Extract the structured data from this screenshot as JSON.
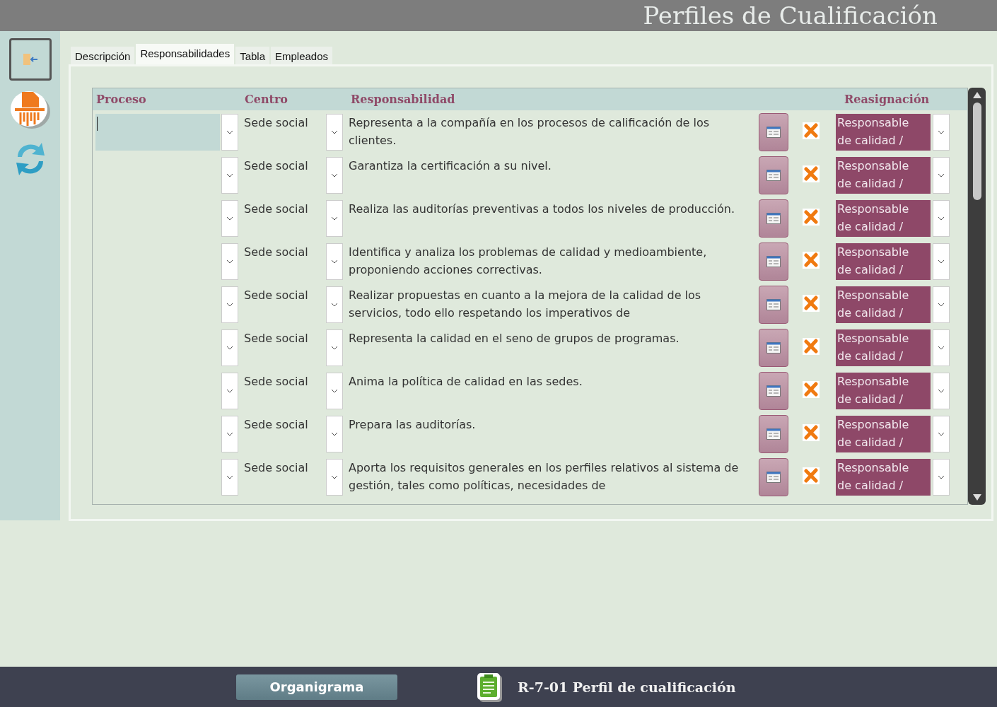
{
  "window": {
    "title": "Perfiles de Cualificación"
  },
  "tabs": [
    {
      "label": "Descripción",
      "selected": false
    },
    {
      "label": "Responsabilidades",
      "selected": true
    },
    {
      "label": "Tabla",
      "selected": false
    },
    {
      "label": "Empleados",
      "selected": false
    }
  ],
  "table": {
    "columns": [
      "Proceso",
      "Centro",
      "Responsabilidad",
      "Reasignación"
    ],
    "rows": [
      {
        "selected": true,
        "centro": "Sede social",
        "responsabilidad": "Representa a la compañía en los procesos de calificación de los clientes.",
        "checked": true,
        "reasignacion": "Responsable de calidad /"
      },
      {
        "selected": false,
        "centro": "Sede social",
        "responsabilidad": "Garantiza la certificación a su nivel.",
        "checked": true,
        "reasignacion": "Responsable de calidad /"
      },
      {
        "selected": false,
        "centro": "Sede social",
        "responsabilidad": "Realiza las auditorías preventivas a todos los niveles de producción.",
        "checked": true,
        "reasignacion": "Responsable de calidad /"
      },
      {
        "selected": false,
        "centro": "Sede social",
        "responsabilidad": "Identifica y analiza los problemas de calidad y medioambiente, proponiendo acciones correctivas.",
        "checked": true,
        "reasignacion": "Responsable de calidad /"
      },
      {
        "selected": false,
        "centro": "Sede social",
        "responsabilidad": "Realizar propuestas en cuanto a la mejora de la calidad de los servicios, todo ello respetando los imperativos de",
        "checked": true,
        "reasignacion": "Responsable de calidad /"
      },
      {
        "selected": false,
        "centro": "Sede social",
        "responsabilidad": "Representa la calidad en el seno de grupos de programas.",
        "checked": true,
        "reasignacion": "Responsable de calidad /"
      },
      {
        "selected": false,
        "centro": "Sede social",
        "responsabilidad": "Anima la política de calidad en las sedes.",
        "checked": true,
        "reasignacion": "Responsable de calidad /"
      },
      {
        "selected": false,
        "centro": "Sede social",
        "responsabilidad": "Prepara las auditorías.",
        "checked": true,
        "reasignacion": "Responsable de calidad /"
      },
      {
        "selected": false,
        "centro": "Sede social",
        "responsabilidad": "Aporta los requisitos generales en los perfiles relativos al sistema de gestión, tales como políticas, necesidades de",
        "checked": true,
        "reasignacion": "Responsable de calidad /"
      }
    ]
  },
  "footer": {
    "button": "Organigrama",
    "document": "R-7-01 Perfil de cualificación"
  }
}
